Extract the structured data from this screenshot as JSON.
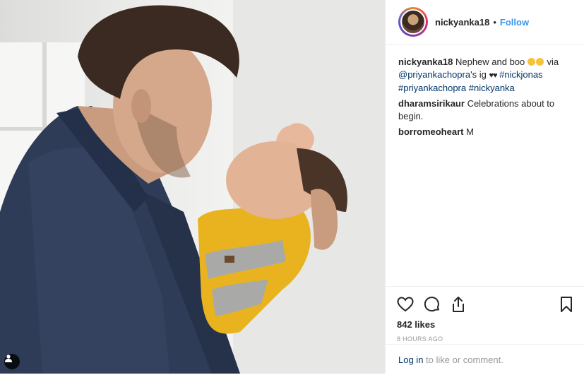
{
  "post": {
    "username": "nickyanka18",
    "separator": "•",
    "follow_label": "Follow",
    "caption": {
      "username": "nickyanka18",
      "text_before": "Nephew and boo",
      "text_via": "via",
      "mention": "@priyankachopra",
      "text_after": "'s ig",
      "hearts": "♥♥",
      "hashtag_1": "#nickjonas",
      "hashtag_2": "#priyankachopra",
      "hashtag_3": "#nickyanka"
    },
    "comments": [
      {
        "username": "dharamsirikaur",
        "text": "Celebrations about to begin."
      },
      {
        "username": "borromeoheart",
        "text": "M"
      }
    ],
    "likes": "842 likes",
    "timestamp": "8 HOURS AGO",
    "login_link": "Log in",
    "login_text": "to like or comment."
  },
  "icons": {
    "like": "heart-icon",
    "comment": "comment-icon",
    "share": "share-icon",
    "save": "bookmark-icon",
    "tag": "user-tag-icon"
  },
  "colors": {
    "link": "#003569",
    "follow": "#3897f0",
    "muted": "#999999"
  }
}
